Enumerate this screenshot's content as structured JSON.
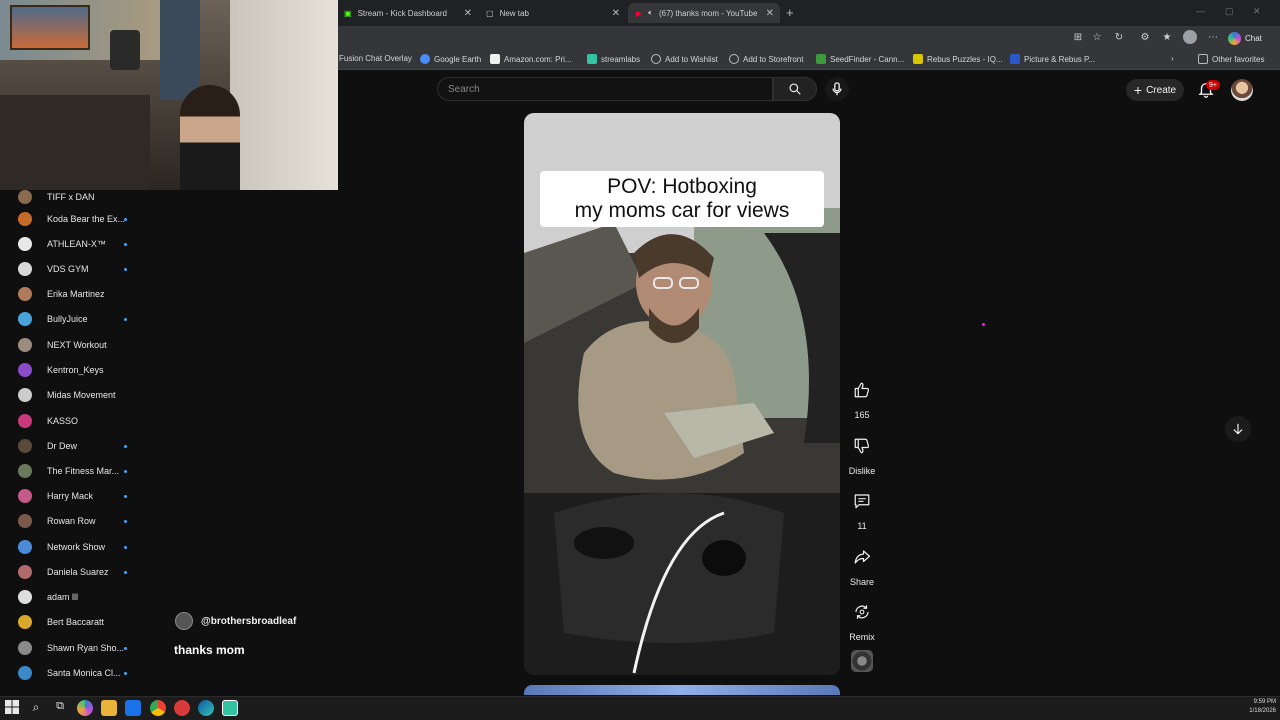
{
  "browser": {
    "tabs": [
      {
        "label": "Stream - Kick Dashboard",
        "active": false
      },
      {
        "label": "New tab",
        "active": false
      },
      {
        "label": "(67) thanks mom - YouTube",
        "active": true
      }
    ],
    "chat_label": "Chat"
  },
  "bookmarks": [
    {
      "label": "Fusion Chat Overlay",
      "color": "#3a3a3a"
    },
    {
      "label": "Google Earth",
      "color": "#4a8df6"
    },
    {
      "label": "Amazon.com: Pri...",
      "color": "#f0f0f0"
    },
    {
      "label": "streamlabs",
      "color": "#31c3a2"
    },
    {
      "label": "Add to Wishlist",
      "color": "#9aa0a6"
    },
    {
      "label": "Add to Storefront",
      "color": "#9aa0a6"
    },
    {
      "label": "SeedFinder - Cann...",
      "color": "#3c9a3c"
    },
    {
      "label": "Rebus Puzzles - IQ...",
      "color": "#d9c400"
    },
    {
      "label": "Picture & Rebus P...",
      "color": "#2a58c8"
    }
  ],
  "other_favorites": "Other favorites",
  "youtube": {
    "search_placeholder": "Search",
    "create_label": "Create",
    "notification_count": "9+"
  },
  "sidebar": {
    "subscriptions": [
      {
        "name": "TIFF x DAN",
        "color": "#8a6b4f",
        "new": false
      },
      {
        "name": "Koda Bear the Ex...",
        "color": "#c46b2a",
        "new": true
      },
      {
        "name": "ATHLEAN-X™",
        "color": "#e8e8e8",
        "new": true
      },
      {
        "name": "VDS GYM",
        "color": "#d9d9d9",
        "new": true
      },
      {
        "name": "Erika Martinez",
        "color": "#b07a5c",
        "new": false
      },
      {
        "name": "BullyJuice",
        "color": "#4aa3d9",
        "new": true
      },
      {
        "name": "NEXT Workout",
        "color": "#9c8c80",
        "new": false
      },
      {
        "name": "Kentron_Keys",
        "color": "#8a4cc9",
        "new": false
      },
      {
        "name": "Midas Movement",
        "color": "#cccccc",
        "new": false
      },
      {
        "name": "KASSO",
        "color": "#c93a7a",
        "new": false
      },
      {
        "name": "Dr Dew",
        "color": "#5a4a3a",
        "new": true
      },
      {
        "name": "The Fitness Mar...",
        "color": "#6a7a5a",
        "new": true
      },
      {
        "name": "Harry Mack",
        "color": "#c45a8a",
        "new": true
      },
      {
        "name": "Rowan Row",
        "color": "#7a5a4a",
        "new": true
      },
      {
        "name": "Network Show",
        "color": "#4a8ad9",
        "new": true
      },
      {
        "name": "Daniela Suarez",
        "color": "#b06a6a",
        "new": true
      },
      {
        "name": "adam lll",
        "color": "#dddddd",
        "new": false
      },
      {
        "name": "Bert Baccaratt",
        "color": "#d9a82a",
        "new": false
      },
      {
        "name": "Shawn Ryan Sho...",
        "color": "#8a8a8a",
        "new": true
      },
      {
        "name": "Santa Monica Cl...",
        "color": "#3a8ac9",
        "new": true
      }
    ]
  },
  "short": {
    "caption_line1": "POV: Hotboxing",
    "caption_line2": "my moms car for views",
    "like_count": "165",
    "dislike_label": "Dislike",
    "comment_count": "11",
    "share_label": "Share",
    "remix_label": "Remix"
  },
  "chat": {
    "username": "@brothersbroadleaf",
    "message": "thanks mom"
  },
  "taskbar": {
    "time": "9:59 PM",
    "date": "1/18/2026"
  }
}
